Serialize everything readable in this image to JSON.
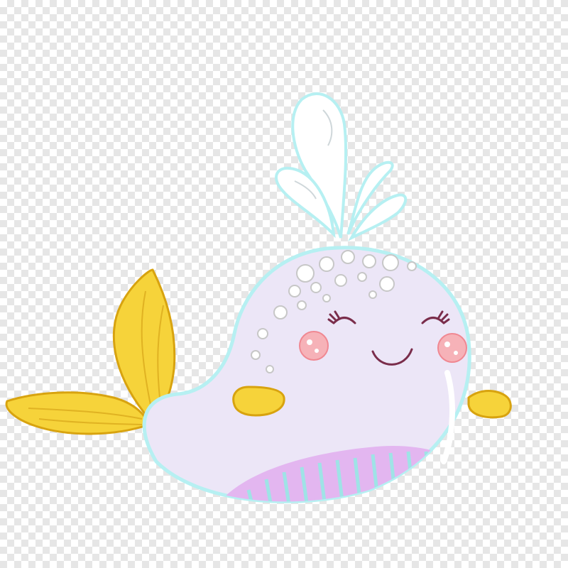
{
  "image": {
    "background": "transparency-checkerboard",
    "subject": "cartoon-whale",
    "colors": {
      "body": "#ece6f7",
      "belly": "#e3b6f0",
      "belly_stripe": "#9fe3e6",
      "fins_tail": "#f6d33a",
      "fin_outline": "#d8a30f",
      "outline_glow": "#b6f0f2",
      "cheeks": "#f6b2b8",
      "smile": "#7a2d4b",
      "water": "#ffffff"
    }
  }
}
